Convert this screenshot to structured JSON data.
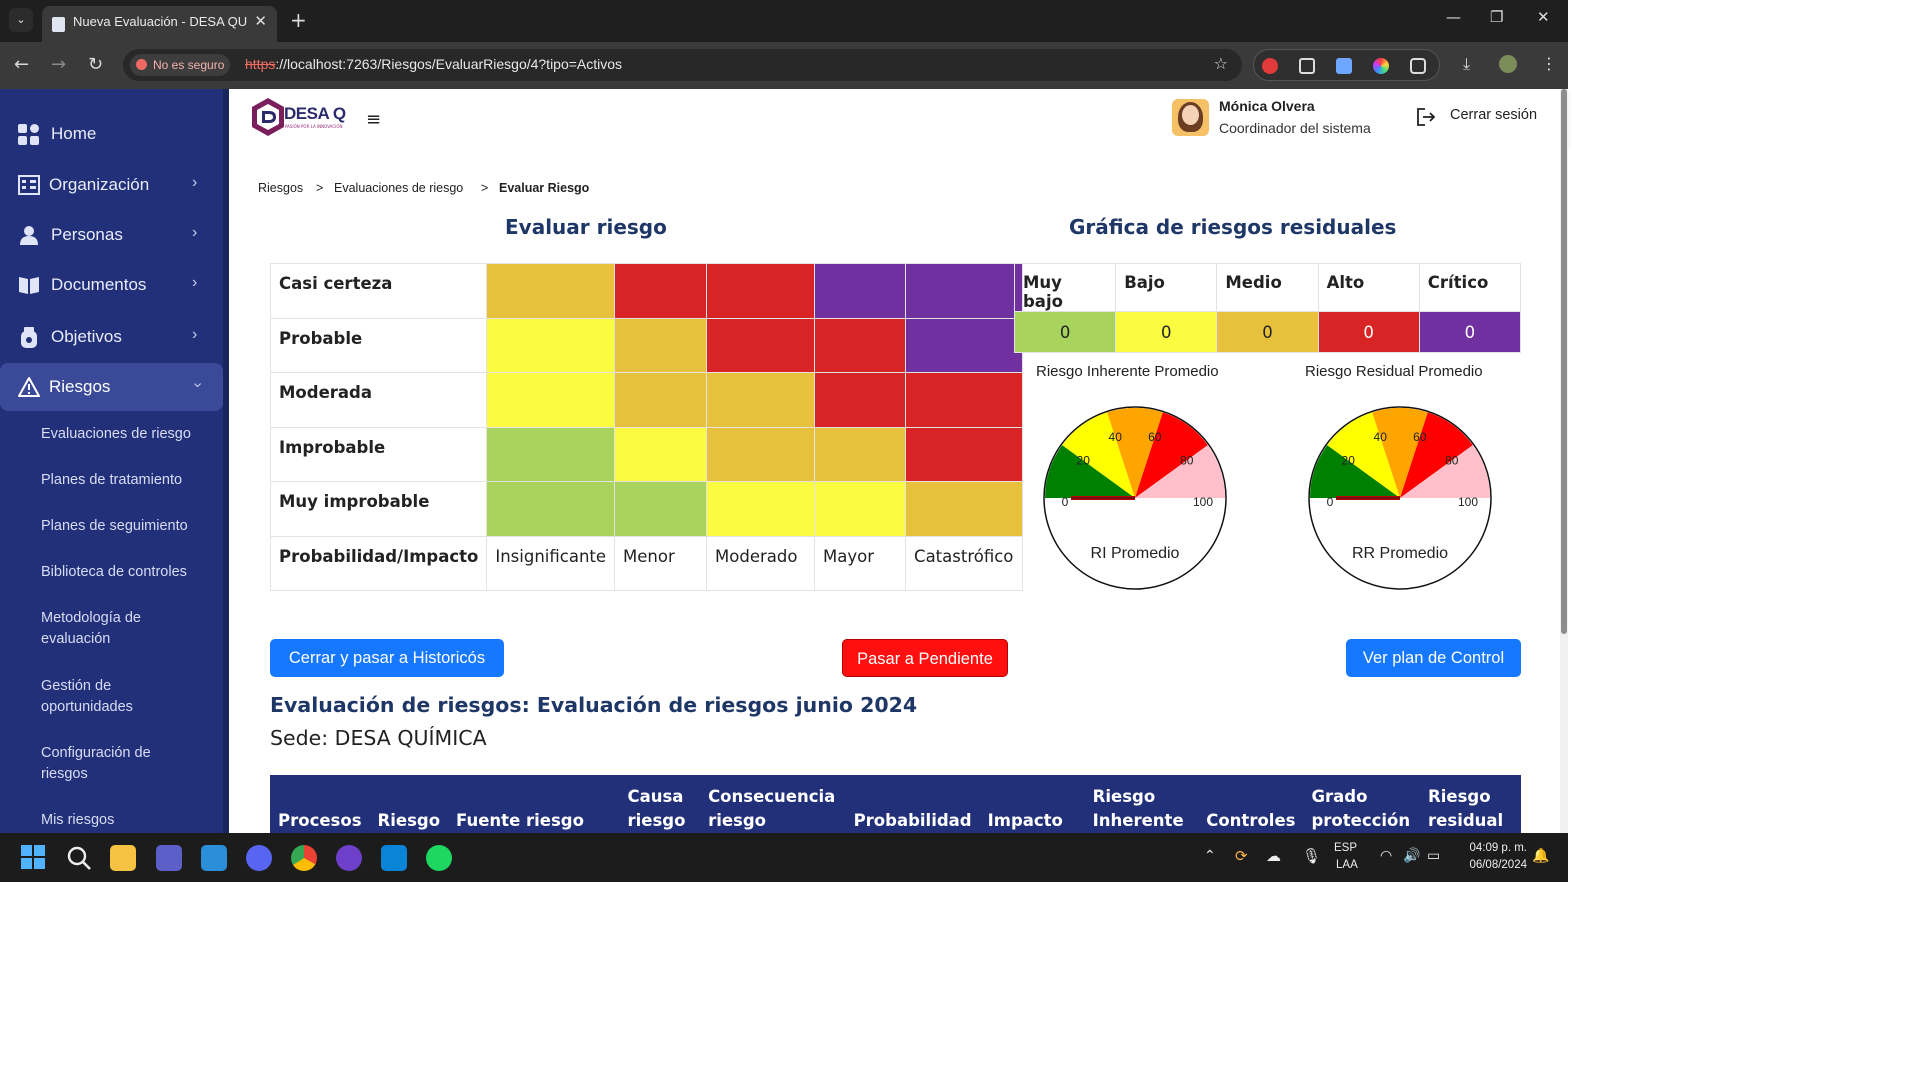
{
  "browser": {
    "tab_title": "Nueva Evaluación - DESA QUÍMICA",
    "security_label": "No es seguro",
    "url_scheme": "https",
    "url_rest": "://localhost:7263/Riesgos/EvaluarRiesgo/4?tipo=Activos"
  },
  "sidebar": {
    "items": [
      {
        "label": "Home",
        "icon": "grid-icon"
      },
      {
        "label": "Organización",
        "icon": "building-icon"
      },
      {
        "label": "Personas",
        "icon": "person-icon"
      },
      {
        "label": "Documentos",
        "icon": "book-icon"
      },
      {
        "label": "Objetivos",
        "icon": "badge-icon"
      },
      {
        "label": "Riesgos",
        "icon": "warning-icon"
      }
    ],
    "subitems": [
      "Evaluaciones de riesgo",
      "Planes de tratamiento",
      "Planes de seguimiento",
      "Biblioteca de controles",
      "Metodología de evaluación",
      "Gestión de oportunidades",
      "Configuración de riesgos",
      "Mis riesgos"
    ]
  },
  "header": {
    "logo_text": "DESA Q",
    "logo_tagline": "PASIÓN POR LA INNOVACIÓN",
    "user_name": "Mónica Olvera",
    "user_role": "Coordinador del sistema",
    "logout_label": "Cerrar sesión"
  },
  "breadcrumb": [
    "Riesgos",
    "Evaluaciones de riesgo",
    "Evaluar Riesgo"
  ],
  "matrix": {
    "title": "Evaluar riesgo",
    "corner_label": "Probabilidad/Impacto",
    "rows": [
      {
        "label": "Casi certeza",
        "cells": [
          "medio",
          "alto",
          "alto",
          "critico",
          "critico"
        ]
      },
      {
        "label": "Probable",
        "cells": [
          "bajo",
          "medio",
          "alto",
          "alto",
          "critico"
        ]
      },
      {
        "label": "Moderada",
        "cells": [
          "bajo",
          "medio",
          "medio",
          "alto",
          "alto"
        ]
      },
      {
        "label": "Improbable",
        "cells": [
          "muybajo",
          "bajo",
          "medio",
          "medio",
          "alto"
        ]
      },
      {
        "label": "Muy improbable",
        "cells": [
          "muybajo",
          "muybajo",
          "bajo",
          "bajo",
          "medio"
        ]
      }
    ],
    "impacts": [
      "Insignificante",
      "Menor",
      "Moderado",
      "Mayor",
      "Catastrófico"
    ]
  },
  "colors": {
    "muybajo": "#a8d45e",
    "bajo": "#fbfb41",
    "medio": "#e8c13c",
    "alto": "#d82424",
    "critico": "#7030a0"
  },
  "residual": {
    "title": "Gráfica de riesgos residuales",
    "levels": [
      {
        "label": "Muy bajo",
        "count": "0",
        "key": "muybajo"
      },
      {
        "label": "Bajo",
        "count": "0",
        "key": "bajo"
      },
      {
        "label": "Medio",
        "count": "0",
        "key": "medio"
      },
      {
        "label": "Alto",
        "count": "0",
        "key": "alto"
      },
      {
        "label": "Crítico",
        "count": "0",
        "key": "critico"
      }
    ],
    "gauges": [
      {
        "title": "Riesgo Inherente Promedio",
        "label": "RI Promedio",
        "value": 0
      },
      {
        "title": "Riesgo Residual Promedio",
        "label": "RR Promedio",
        "value": 0
      }
    ],
    "gauge_ticks": [
      "0",
      "20",
      "40",
      "60",
      "80",
      "100"
    ]
  },
  "actions": {
    "close_label": "Cerrar y pasar a Historicós",
    "pending_label": "Pasar a Pendiente",
    "control_label": "Ver plan de Control"
  },
  "evaluation": {
    "heading": "Evaluación de riesgos: Evaluación de riesgos junio 2024",
    "sede": "Sede: DESA QUÍMICA"
  },
  "table": {
    "columns": [
      "Procesos",
      "Riesgo",
      "Fuente riesgo",
      "Causa riesgo",
      "Consecuencia riesgo",
      "Probabilidad",
      "Impacto",
      "Riesgo Inherente",
      "Controles",
      "Grado protección",
      "Riesgo residual"
    ]
  },
  "taskbar": {
    "lang": "ESP",
    "layout": "LAA",
    "time": "04:09 p. m.",
    "date": "06/08/2024"
  }
}
